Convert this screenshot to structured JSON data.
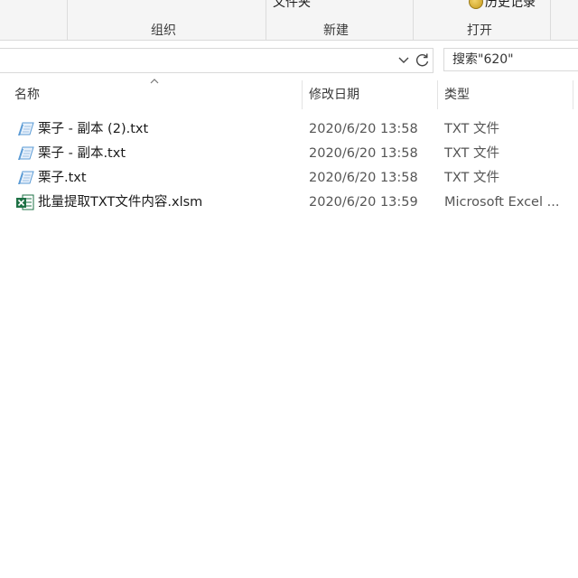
{
  "ribbon": {
    "top_cut_left": "文件夹",
    "history_label": "历史记录",
    "groups": [
      "组织",
      "新建",
      "打开"
    ]
  },
  "addressbar": {
    "search_placeholder": "搜索\"620\""
  },
  "columns": [
    "名称",
    "修改日期",
    "类型"
  ],
  "files": [
    {
      "name": "栗子 - 副本 (2).txt",
      "modified": "2020/6/20 13:58",
      "type": "TXT 文件",
      "icon": "text-file-icon"
    },
    {
      "name": "栗子 - 副本.txt",
      "modified": "2020/6/20 13:58",
      "type": "TXT 文件",
      "icon": "text-file-icon"
    },
    {
      "name": "栗子.txt",
      "modified": "2020/6/20 13:58",
      "type": "TXT 文件",
      "icon": "text-file-icon"
    },
    {
      "name": "批量提取TXT文件内容.xlsm",
      "modified": "2020/6/20 13:59",
      "type": "Microsoft Excel ...",
      "icon": "excel-file-icon"
    }
  ],
  "colors": {
    "ribbon_bg": "#f5f5f5",
    "excel_green": "#1e7145",
    "text_icon_blue": "#5b9bd5"
  }
}
